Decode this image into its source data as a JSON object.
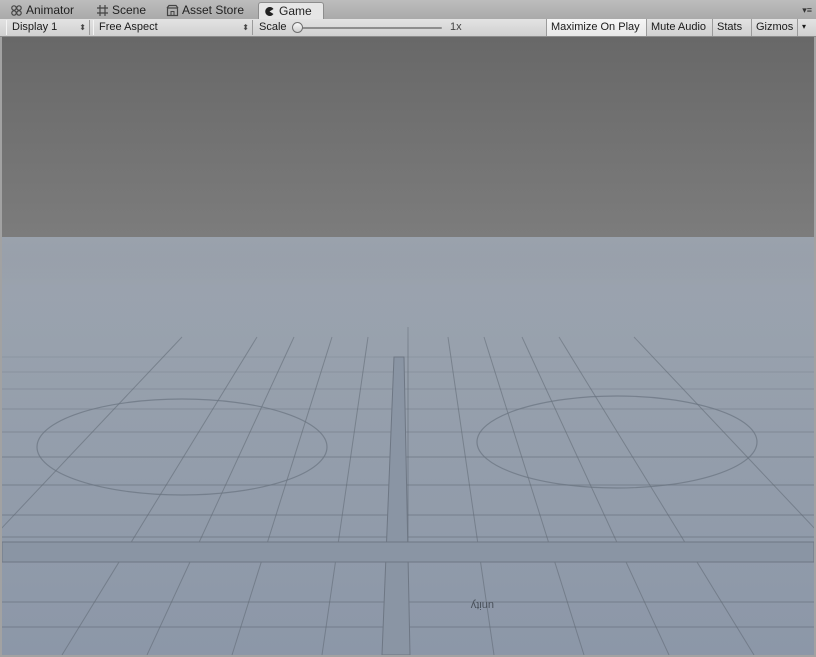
{
  "tabs": [
    {
      "label": "Animator",
      "icon": "animator-icon"
    },
    {
      "label": "Scene",
      "icon": "hash-icon"
    },
    {
      "label": "Asset Store",
      "icon": "store-icon"
    },
    {
      "label": "Game",
      "icon": "pacman-icon",
      "active": true
    }
  ],
  "toolbar": {
    "display": "Display 1",
    "aspect": "Free Aspect",
    "scale_label": "Scale",
    "scale_value": "1x",
    "scale_level": 0,
    "maximize": "Maximize On Play",
    "mute": "Mute Audio",
    "stats": "Stats",
    "gizmos": "Gizmos"
  },
  "viewport": {
    "floor_logo_text": "unity",
    "colors": {
      "sky": "#6a6a6a",
      "floor": "#8f9aaa",
      "grid_line": "#5c6470"
    }
  }
}
